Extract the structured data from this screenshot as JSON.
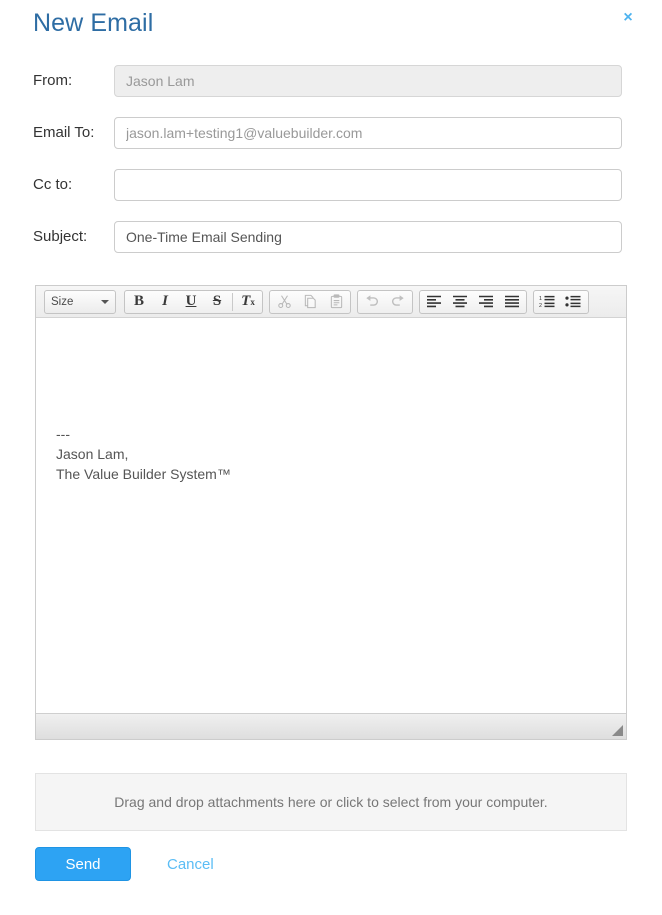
{
  "dialog": {
    "title": "New Email",
    "close_label": "×"
  },
  "form": {
    "from": {
      "label": "From:",
      "value": "Jason Lam",
      "placeholder": "",
      "disabled": true
    },
    "email_to": {
      "label": "Email To:",
      "value": "",
      "placeholder": "jason.lam+testing1@valuebuilder.com"
    },
    "cc_to": {
      "label": "Cc to:",
      "value": "",
      "placeholder": ""
    },
    "subject": {
      "label": "Subject:",
      "value": "One-Time Email Sending",
      "placeholder": ""
    }
  },
  "editor": {
    "size_dropdown": {
      "label": "Size",
      "icon": "chevron-down-icon"
    },
    "groups": [
      {
        "name": "text-format",
        "buttons": [
          {
            "name": "bold-button",
            "glyph": "B",
            "style": "fmt-b",
            "enabled": true
          },
          {
            "name": "italic-button",
            "glyph": "I",
            "style": "fmt-i",
            "enabled": true
          },
          {
            "name": "underline-button",
            "glyph": "U",
            "style": "fmt-u",
            "enabled": true
          },
          {
            "name": "strikethrough-button",
            "glyph": "S",
            "style": "fmt-s",
            "enabled": true
          },
          {
            "name": "remove-format-button",
            "glyph": "Tx",
            "style": "fmt-tx",
            "enabled": true
          }
        ]
      },
      {
        "name": "clipboard",
        "buttons": [
          {
            "name": "cut-icon",
            "glyph": "✂",
            "enabled": false
          },
          {
            "name": "copy-icon",
            "glyph": "⧉",
            "enabled": false
          },
          {
            "name": "paste-icon",
            "glyph": "📋",
            "enabled": false
          }
        ]
      },
      {
        "name": "history",
        "buttons": [
          {
            "name": "undo-icon",
            "glyph": "↶",
            "enabled": false
          },
          {
            "name": "redo-icon",
            "glyph": "↷",
            "enabled": false
          }
        ]
      },
      {
        "name": "alignment",
        "buttons": [
          {
            "name": "align-left-icon",
            "glyph": "",
            "enabled": true
          },
          {
            "name": "align-center-icon",
            "glyph": "",
            "enabled": true
          },
          {
            "name": "align-right-icon",
            "glyph": "",
            "enabled": true
          },
          {
            "name": "align-justify-icon",
            "glyph": "",
            "enabled": true
          }
        ]
      },
      {
        "name": "lists",
        "buttons": [
          {
            "name": "numbered-list-icon",
            "glyph": "",
            "enabled": true
          },
          {
            "name": "bulleted-list-icon",
            "glyph": "",
            "enabled": true
          }
        ]
      }
    ],
    "body": {
      "signature_separator": "---",
      "signature_name": "Jason Lam,",
      "signature_company": "The Value Builder System™"
    },
    "resize_handle": "resize-grip-icon"
  },
  "dropzone": {
    "text": "Drag and drop attachments here or click to select from your computer."
  },
  "actions": {
    "send_label": "Send",
    "cancel_label": "Cancel"
  },
  "colors": {
    "title": "#2e6da4",
    "primary_button": "#2da3f3",
    "link": "#5bbdf5",
    "close": "#4eb3ef"
  }
}
